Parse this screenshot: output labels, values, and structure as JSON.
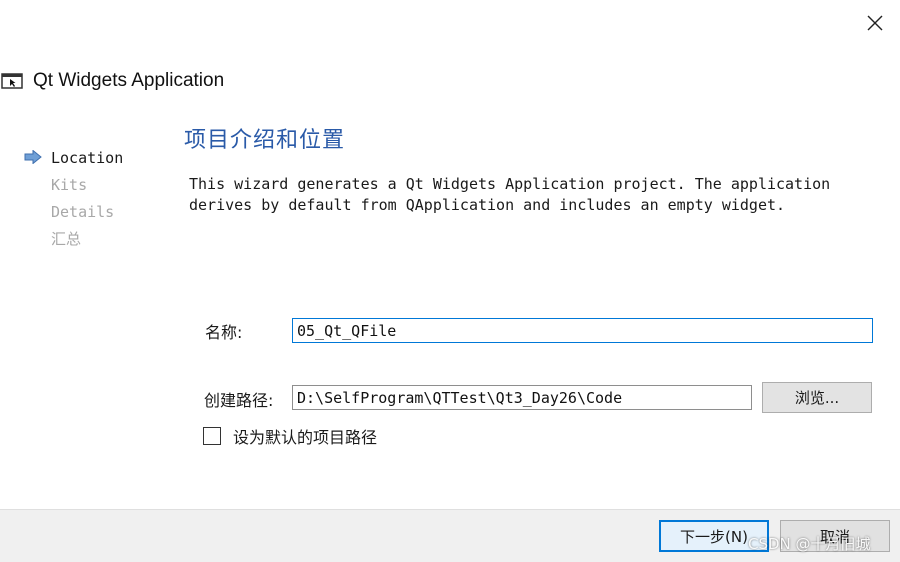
{
  "window": {
    "title": "Qt Widgets Application",
    "app_icon": "qt-app-window-icon",
    "close_icon": "close-icon"
  },
  "steps": [
    {
      "label": "Location",
      "active": true
    },
    {
      "label": "Kits",
      "active": false
    },
    {
      "label": "Details",
      "active": false
    },
    {
      "label": "汇总",
      "active": false
    }
  ],
  "page": {
    "title": "项目介绍和位置",
    "description_line1": "This wizard generates a Qt Widgets Application project. The application",
    "description_line2": "derives by default from QApplication and includes an empty widget."
  },
  "form": {
    "name_label": "名称:",
    "name_value": "05_Qt_QFile",
    "path_label": "创建路径:",
    "path_value": "D:\\SelfProgram\\QTTest\\Qt3_Day26\\Code",
    "browse_label": "浏览...",
    "default_path_checkbox_label": "设为默认的项目路径",
    "default_path_checked": false
  },
  "footer": {
    "next_label": "下一步(N)",
    "cancel_label": "取消"
  },
  "watermark": "CSDN @十月旧城",
  "colors": {
    "accent": "#0078d7",
    "page_title": "#2a5aa8",
    "inactive_step": "#a8a8a8",
    "footer_bg": "#f0f0f0"
  }
}
